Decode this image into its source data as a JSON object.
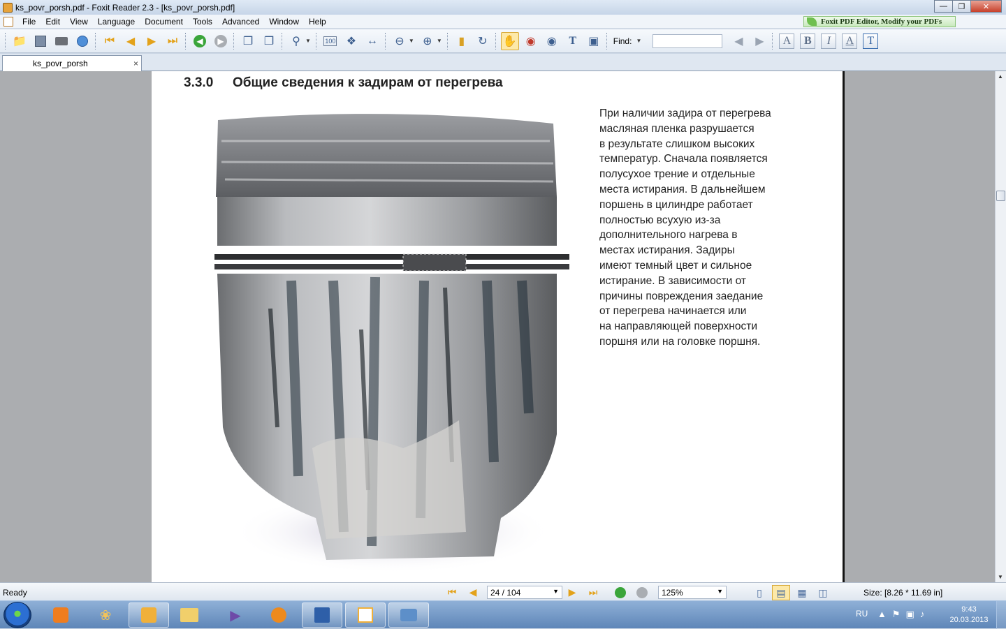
{
  "window": {
    "title": "ks_povr_porsh.pdf - Foxit Reader 2.3 - [ks_povr_porsh.pdf]",
    "minimize_icon": "minimize-icon",
    "restore_icon": "restore-icon",
    "close_icon": "close-icon"
  },
  "menu": {
    "items": [
      "File",
      "Edit",
      "View",
      "Language",
      "Document",
      "Tools",
      "Advanced",
      "Window",
      "Help"
    ],
    "banner": "Foxit PDF Editor, Modify your PDFs"
  },
  "toolbar": {
    "find_label": "Find:",
    "find_value": "",
    "format_buttons": [
      "A",
      "B",
      "I",
      "A",
      "T"
    ]
  },
  "tab": {
    "name": "ks_povr_porsh",
    "close": "×"
  },
  "document": {
    "section_number": "3.3.0",
    "section_title": "Общие сведения к задирам от перегрева",
    "paragraph_lines": [
      "При наличии задира от перегрева",
      "масляная пленка разрушается",
      "в результате слишком высоких",
      "температур. Сначала появляется",
      "полусухое трение и отдельные",
      "места истирания. В дальнейшем",
      "поршень в цилиндре работает",
      "полностью всухую из-за",
      "дополнительного нагрева в",
      "местах истирания. Задиры",
      "имеют темный цвет и сильное",
      "истирание. В зависимости от",
      "причины повреждения заедание",
      "от перегрева начинается или",
      "на направляющей поверхности",
      "поршня или на головке поршня."
    ],
    "image_subject": "scuffed-piston-photo"
  },
  "status": {
    "text": "Ready",
    "page": "24 / 104",
    "zoom": "125%",
    "size": "Size: [8.26 * 11.69 in]"
  },
  "taskbar": {
    "language": "RU",
    "time": "9:43",
    "date": "20.03.2013"
  },
  "colors": {
    "accent": "#fde9a8",
    "nav_arrow": "#e3a21a",
    "go_green": "#3aa53a"
  }
}
